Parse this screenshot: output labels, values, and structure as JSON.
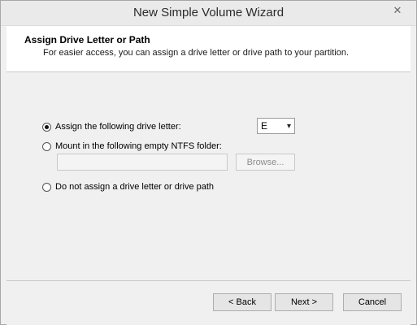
{
  "window": {
    "title": "New Simple Volume Wizard",
    "close_glyph": "✕"
  },
  "header": {
    "title": "Assign Drive Letter or Path",
    "subtitle": "For easier access, you can assign a drive letter or drive path to your partition."
  },
  "options": {
    "assign_letter": {
      "label": "Assign the following drive letter:",
      "selected": true
    },
    "mount_folder": {
      "label": "Mount in the following empty NTFS folder:",
      "selected": false
    },
    "no_assign": {
      "label": "Do not assign a drive letter or drive path",
      "selected": false
    }
  },
  "drive_letter": {
    "value": "E",
    "arrow": "▾"
  },
  "folder_path": {
    "value": ""
  },
  "browse_label": "Browse...",
  "buttons": {
    "back": "< Back",
    "next": "Next >",
    "cancel": "Cancel"
  }
}
